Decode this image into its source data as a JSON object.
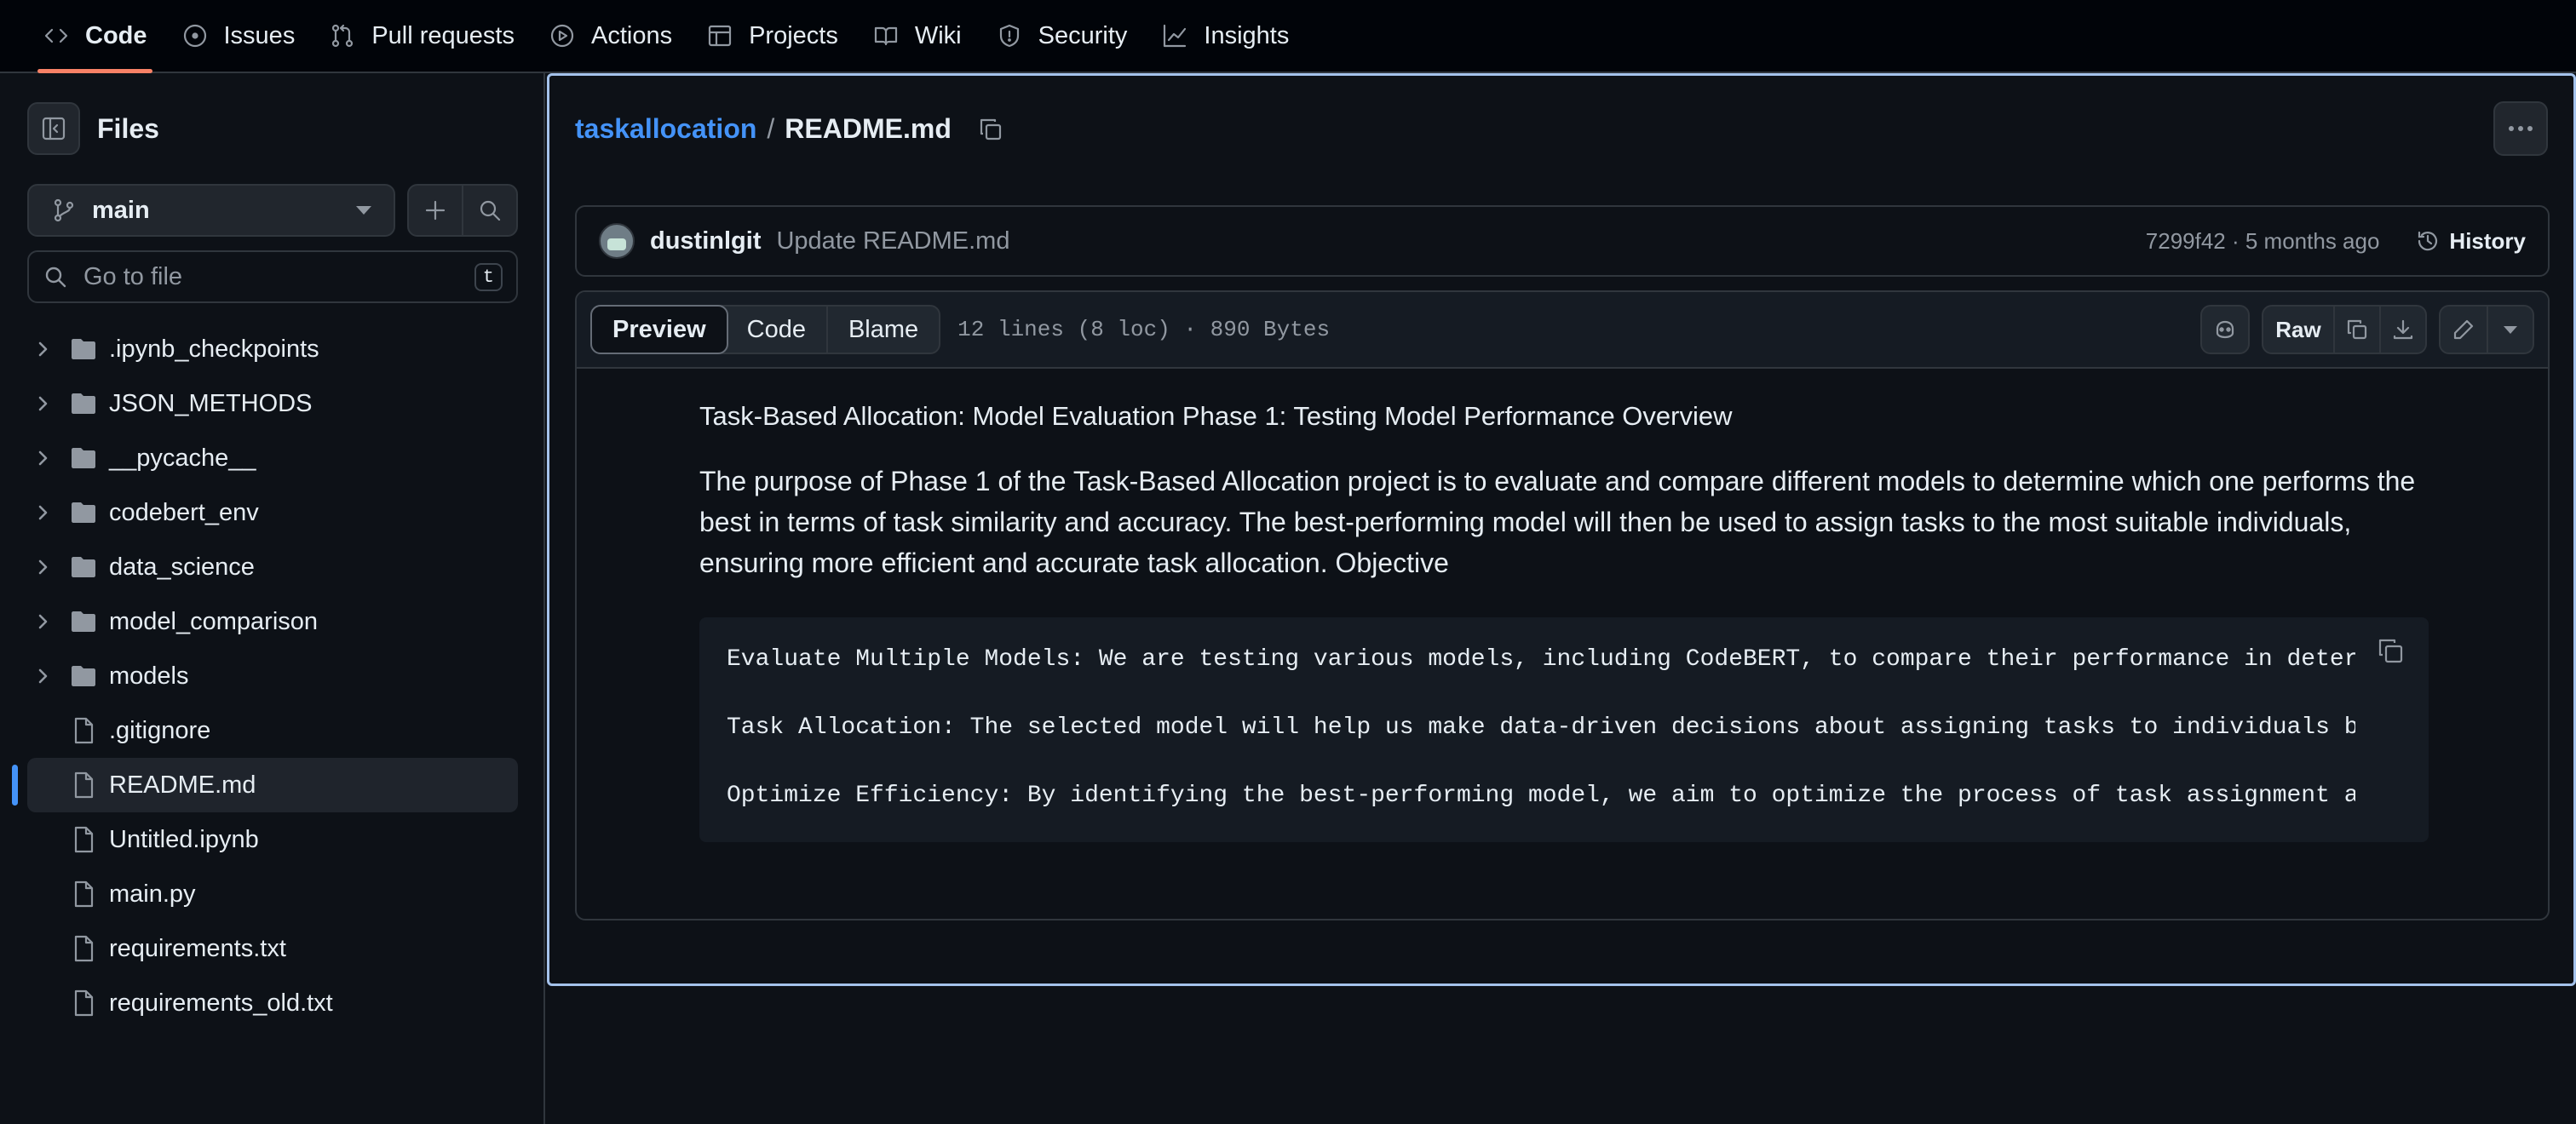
{
  "nav": {
    "tabs": [
      {
        "label": "Code",
        "icon": "code-icon",
        "active": true
      },
      {
        "label": "Issues",
        "icon": "issue-icon"
      },
      {
        "label": "Pull requests",
        "icon": "pull-request-icon"
      },
      {
        "label": "Actions",
        "icon": "play-icon"
      },
      {
        "label": "Projects",
        "icon": "table-icon"
      },
      {
        "label": "Wiki",
        "icon": "book-icon"
      },
      {
        "label": "Security",
        "icon": "shield-icon"
      },
      {
        "label": "Insights",
        "icon": "graph-icon"
      }
    ]
  },
  "sidebar": {
    "title": "Files",
    "branch": "main",
    "search_placeholder": "Go to file",
    "search_shortcut": "t",
    "tree": [
      {
        "name": ".ipynb_checkpoints",
        "type": "folder"
      },
      {
        "name": "JSON_METHODS",
        "type": "folder"
      },
      {
        "name": "__pycache__",
        "type": "folder"
      },
      {
        "name": "codebert_env",
        "type": "folder"
      },
      {
        "name": "data_science",
        "type": "folder"
      },
      {
        "name": "model_comparison",
        "type": "folder"
      },
      {
        "name": "models",
        "type": "folder"
      },
      {
        "name": ".gitignore",
        "type": "file"
      },
      {
        "name": "README.md",
        "type": "file",
        "selected": true
      },
      {
        "name": "Untitled.ipynb",
        "type": "file"
      },
      {
        "name": "main.py",
        "type": "file"
      },
      {
        "name": "requirements.txt",
        "type": "file"
      },
      {
        "name": "requirements_old.txt",
        "type": "file"
      }
    ]
  },
  "breadcrumb": {
    "repo": "taskallocation",
    "separator": "/",
    "file": "README.md"
  },
  "commit": {
    "author": "dustinlgit",
    "message": "Update README.md",
    "sha_age": "7299f42 · 5 months ago",
    "history_label": "History"
  },
  "file_header": {
    "views": [
      "Preview",
      "Code",
      "Blame"
    ],
    "active_view": "Preview",
    "meta": "12 lines (8 loc) · 890 Bytes",
    "raw_label": "Raw"
  },
  "readme": {
    "heading": "Task-Based Allocation: Model Evaluation Phase 1: Testing Model Performance Overview",
    "paragraph": "The purpose of Phase 1 of the Task-Based Allocation project is to evaluate and compare different models to determine which one performs the best in terms of task similarity and accuracy. The best-performing model will then be used to assign tasks to the most suitable individuals, ensuring more efficient and accurate task allocation. Objective",
    "code_lines": [
      "Evaluate Multiple Models: We are testing various models, including CodeBERT, to compare their performance in determining task similarity.",
      "Task Allocation: The selected model will help us make data-driven decisions about assigning tasks to individuals based on their skills.",
      "Optimize Efficiency: By identifying the best-performing model, we aim to optimize the process of task assignment and improve productivity."
    ]
  },
  "colors": {
    "accent": "#4493f8",
    "tab_underline": "#f78166",
    "background": "#0d1117"
  }
}
